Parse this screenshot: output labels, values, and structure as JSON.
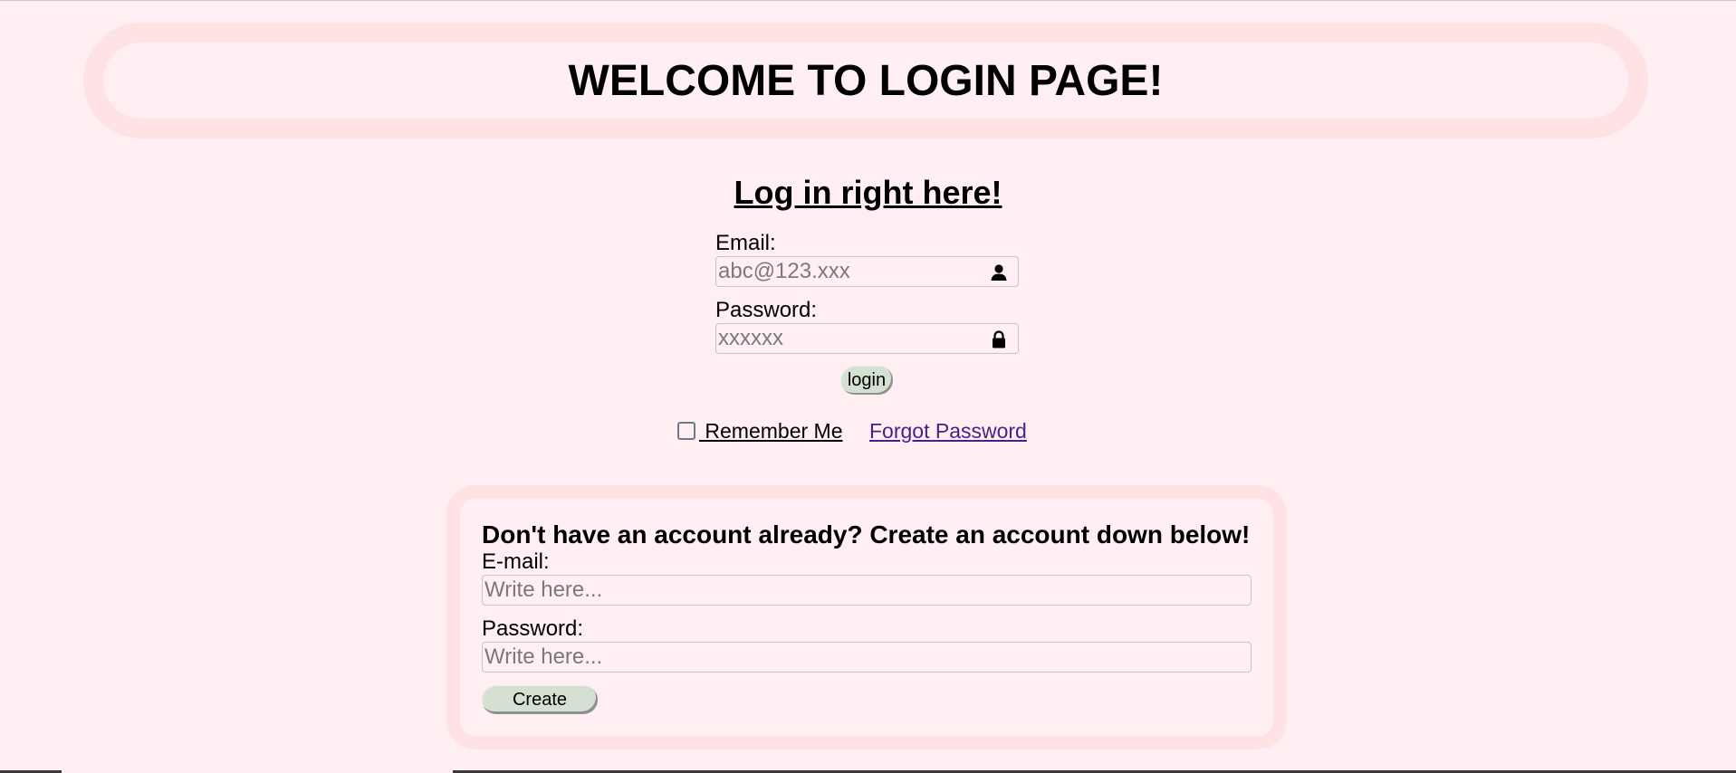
{
  "header": {
    "title": "WELCOME TO LOGIN PAGE!"
  },
  "login": {
    "heading": "Log in right here!",
    "email_label": "Email:",
    "email_placeholder": "abc@123.xxx",
    "email_icon": "user-icon",
    "password_label": "Password:",
    "password_placeholder": "xxxxxx",
    "password_icon": "lock-icon",
    "login_label": "login",
    "remember_label": " Remember Me",
    "remember_checked": false,
    "forgot_label": "Forgot Password"
  },
  "signup": {
    "heading": "Don't have an account already? Create an account down below!",
    "email_label": "E-mail:",
    "email_placeholder": "Write here...",
    "password_label": "Password:",
    "password_placeholder": "Write here...",
    "create_label": "Create"
  },
  "colors": {
    "background": "#ffeef2",
    "border_pink": "#ffe3e4",
    "button_green": "#d3e0d2",
    "link_purple": "#4a1d8c"
  }
}
